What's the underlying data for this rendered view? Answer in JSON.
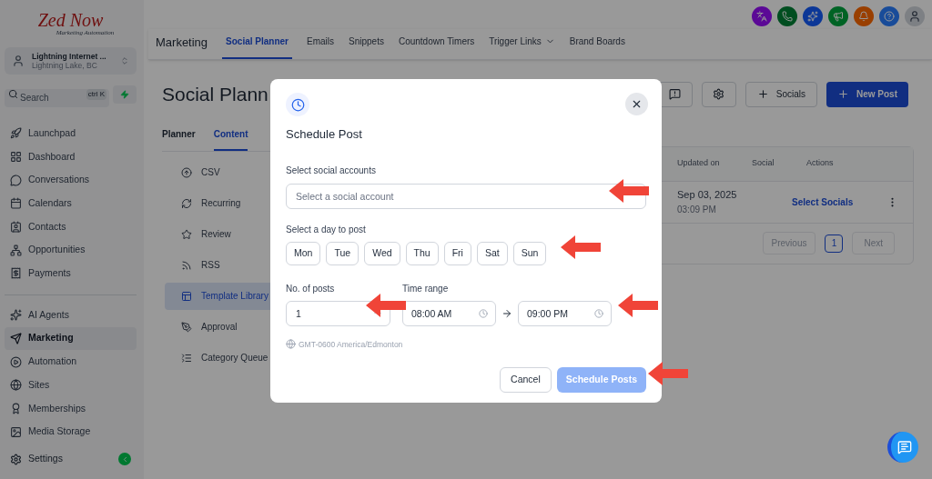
{
  "sidebar": {
    "logo": {
      "name": "Zed Now",
      "tagline": "Marketing Automation"
    },
    "account": {
      "name": "Lightning Internet ...",
      "location": "Lightning Lake, BC"
    },
    "search": {
      "placeholder": "Search",
      "shortcut": "ctrl K"
    },
    "sections": [
      {
        "items": [
          {
            "label": "Launchpad",
            "selected": false
          },
          {
            "label": "Dashboard",
            "selected": false
          },
          {
            "label": "Conversations",
            "selected": false
          },
          {
            "label": "Calendars",
            "selected": false
          },
          {
            "label": "Contacts",
            "selected": false
          },
          {
            "label": "Opportunities",
            "selected": false
          },
          {
            "label": "Payments",
            "selected": false
          }
        ]
      },
      {
        "items": [
          {
            "label": "AI Agents",
            "selected": false
          },
          {
            "label": "Marketing",
            "selected": true
          },
          {
            "label": "Automation",
            "selected": false
          },
          {
            "label": "Sites",
            "selected": false
          },
          {
            "label": "Memberships",
            "selected": false
          },
          {
            "label": "Media Storage",
            "selected": false
          }
        ]
      }
    ],
    "settings": "Settings"
  },
  "header": {
    "title": "Marketing",
    "tabs": [
      {
        "label": "Social Planner",
        "selected": true,
        "has_menu": false
      },
      {
        "label": "Emails",
        "selected": false,
        "has_menu": false
      },
      {
        "label": "Snippets",
        "selected": false,
        "has_menu": false
      },
      {
        "label": "Countdown Timers",
        "selected": false,
        "has_menu": false
      },
      {
        "label": "Trigger Links",
        "selected": false,
        "has_menu": true
      },
      {
        "label": "Brand Boards",
        "selected": false,
        "has_menu": false
      }
    ]
  },
  "page": {
    "title": "Social Plann",
    "buttons": [
      {
        "label": "Socials",
        "primary": false
      },
      {
        "label": "New Post",
        "primary": true
      }
    ],
    "subtabs": [
      {
        "label": "Planner",
        "selected": false
      },
      {
        "label": "Content",
        "selected": true
      }
    ],
    "content_menu": [
      {
        "label": "CSV",
        "selected": false
      },
      {
        "label": "Recurring",
        "selected": false
      },
      {
        "label": "Review",
        "selected": false
      },
      {
        "label": "RSS",
        "selected": false
      },
      {
        "label": "Template Library",
        "selected": true
      },
      {
        "label": "Approval",
        "selected": false
      },
      {
        "label": "Category Queue",
        "selected": false
      }
    ],
    "table": {
      "columns": [
        "Updated on",
        "Social",
        "Actions"
      ],
      "rows": [
        {
          "date": "Sep 03, 2025",
          "time": "03:09 PM",
          "action": "Select Socials"
        }
      ]
    },
    "pagination": {
      "previous": "Previous",
      "pages": [
        {
          "label": "1",
          "selected": true
        }
      ],
      "next": "Next"
    }
  },
  "modal": {
    "title": "Schedule Post",
    "accounts_label": "Select social accounts",
    "accounts_placeholder": "Select a social account",
    "days_label": "Select a day to post",
    "days": [
      {
        "label": "Mon",
        "selected": false
      },
      {
        "label": "Tue",
        "selected": false
      },
      {
        "label": "Wed",
        "selected": false
      },
      {
        "label": "Thu",
        "selected": false
      },
      {
        "label": "Fri",
        "selected": false
      },
      {
        "label": "Sat",
        "selected": false
      },
      {
        "label": "Sun",
        "selected": false
      }
    ],
    "posts_label": "No. of posts",
    "posts_value": "1",
    "time_label": "Time range",
    "time_from": "08:00 AM",
    "time_to": "09:00 PM",
    "timezone": "GMT-0600 America/Edmonton",
    "cancel": "Cancel",
    "submit": {
      "label": "Schedule Posts",
      "disabled": true
    }
  }
}
